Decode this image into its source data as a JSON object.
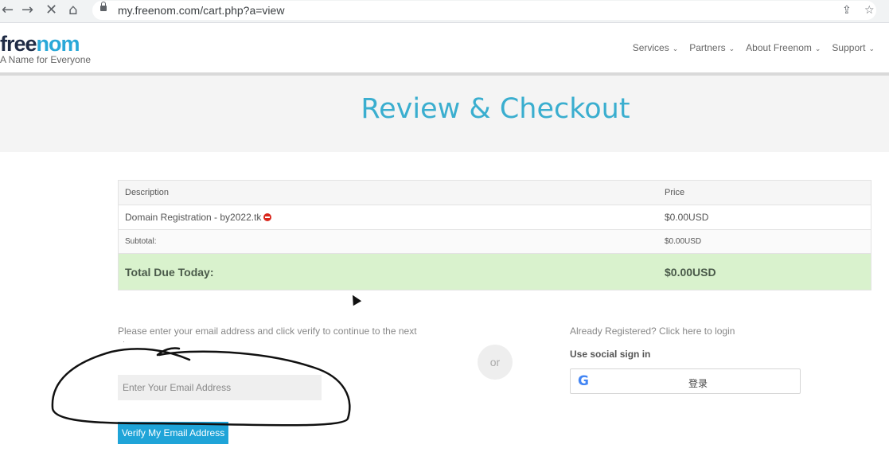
{
  "browser": {
    "url": "my.freenom.com/cart.php?a=view",
    "back_icon": "←",
    "forward_icon": "→",
    "stop_icon": "✕",
    "home_icon": "⌂",
    "share_icon": "⇪",
    "star_icon": "☆"
  },
  "header": {
    "logo_part1": "free",
    "logo_part2": "nom",
    "tagline": "A Name for Everyone",
    "menu": [
      {
        "label": "Services"
      },
      {
        "label": "Partners"
      },
      {
        "label": "About Freenom"
      },
      {
        "label": "Support"
      }
    ],
    "chevron": "⌄"
  },
  "hero": {
    "title": "Review & Checkout"
  },
  "cart": {
    "columns": [
      "Description",
      "Price"
    ],
    "item": {
      "description": "Domain Registration - by2022.tk",
      "price": "$0.00USD"
    },
    "subtotal": {
      "label": "Subtotal:",
      "value": "$0.00USD"
    },
    "total": {
      "label": "Total Due Today:",
      "value": "$0.00USD"
    }
  },
  "verify": {
    "instruction": "Please enter your email address and click verify to continue to the next step",
    "email_placeholder": "Enter Your Email Address",
    "button_label": "Verify My Email Address"
  },
  "divider": {
    "or_label": "or"
  },
  "login": {
    "link_text": "Already Registered? Click here to login",
    "social_title": "Use social sign in",
    "google_icon": "G",
    "google_button_label": "登录"
  },
  "colors": {
    "accent": "#1fa4d8",
    "title": "#3aaecf",
    "total_row": "#d9f2cd",
    "remove": "#d9261c"
  }
}
